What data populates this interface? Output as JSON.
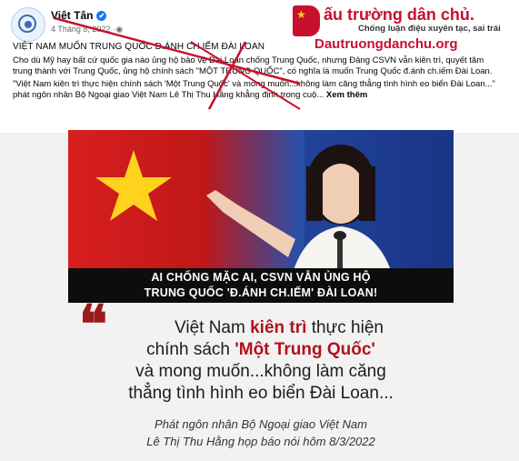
{
  "post": {
    "page_name": "Việt Tân",
    "verified_mark": "✔",
    "date": "4 Tháng 8, 2022",
    "visibility_icon": "globe-icon",
    "title": "VIỆT NAM MUỐN TRUNG QUỐC Đ.ÁNH CH.IẾM ĐÀI LOAN",
    "paragraph_1": "Cho dù Mỹ hay bất cứ quốc gia nào ủng hộ bảo vệ Đài Loan chống Trung Quốc, nhưng Đảng CSVN vẫn kiên trì, quyết tâm trung thành với Trung Quốc, ủng hộ chính sách \"MỘT TRUNG QUỐC\", có nghĩa là muốn Trung Quốc đ.ánh ch.iếm Đài Loan.",
    "paragraph_2": "\"Việt Nam kiên trì thực hiện chính sách 'Một Trung Quốc' và mong muốn...không làm căng thẳng tình hình eo biển Đài Loan...\" phát ngôn nhân Bộ Ngoại giao Việt Nam Lê Thị Thu Hằng khẳng định trong cuộ...",
    "see_more": "Xem thêm"
  },
  "brand": {
    "title": "ấu trường dân chủ.",
    "tagline": "Chống luận điệu xuyên tạc, sai trái",
    "site": "Dautruongdanchu.org",
    "color": "#c8102e"
  },
  "image": {
    "caption_line_1": "AI CHỐNG MẶC AI, CSVN VẪN ỦNG HỘ",
    "caption_line_2": "TRUNG QUỐC 'Đ.ÁNH CH.IẾM' ĐÀI LOAN!",
    "quote_mark": "❝",
    "quote_line_1_a": "Việt Nam ",
    "quote_line_1_b": "kiên trì",
    "quote_line_1_c": " thực hiện",
    "quote_line_2_a": "chính sách ",
    "quote_line_2_b": "'Một Trung Quốc'",
    "quote_line_3": "và mong muốn...không làm căng",
    "quote_line_4": "thẳng tình hình eo biển Đài Loan...",
    "attribution_1": "Phát ngôn nhân Bộ Ngoại giao Việt Nam",
    "attribution_2": "Lê Thị Thu Hằng họp báo nói hôm 8/3/2022",
    "accent_color": "#b0131b"
  }
}
